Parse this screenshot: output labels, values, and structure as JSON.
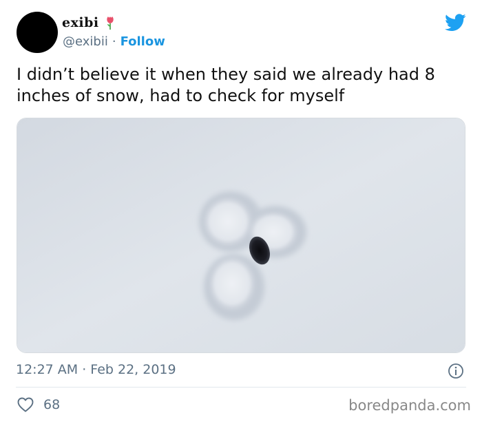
{
  "tweet": {
    "display_name": "exibi",
    "handle": "@exibii",
    "separator": "·",
    "follow_label": "Follow",
    "text": "I didn’t believe it when they said we already had 8 inches of snow, had to check for myself",
    "timestamp": "12:27 AM · Feb 22, 2019",
    "likes": "68"
  },
  "icons": {
    "brand": "twitter-bird-icon",
    "info": "info-icon",
    "like": "heart-icon",
    "name_emoji": "flower-icon"
  },
  "colors": {
    "twitter_blue": "#1da1f2",
    "follow_blue": "#1b95e0",
    "muted_text": "#5b7083",
    "snow": "#dde2e9"
  },
  "watermark": "boredpanda.com"
}
